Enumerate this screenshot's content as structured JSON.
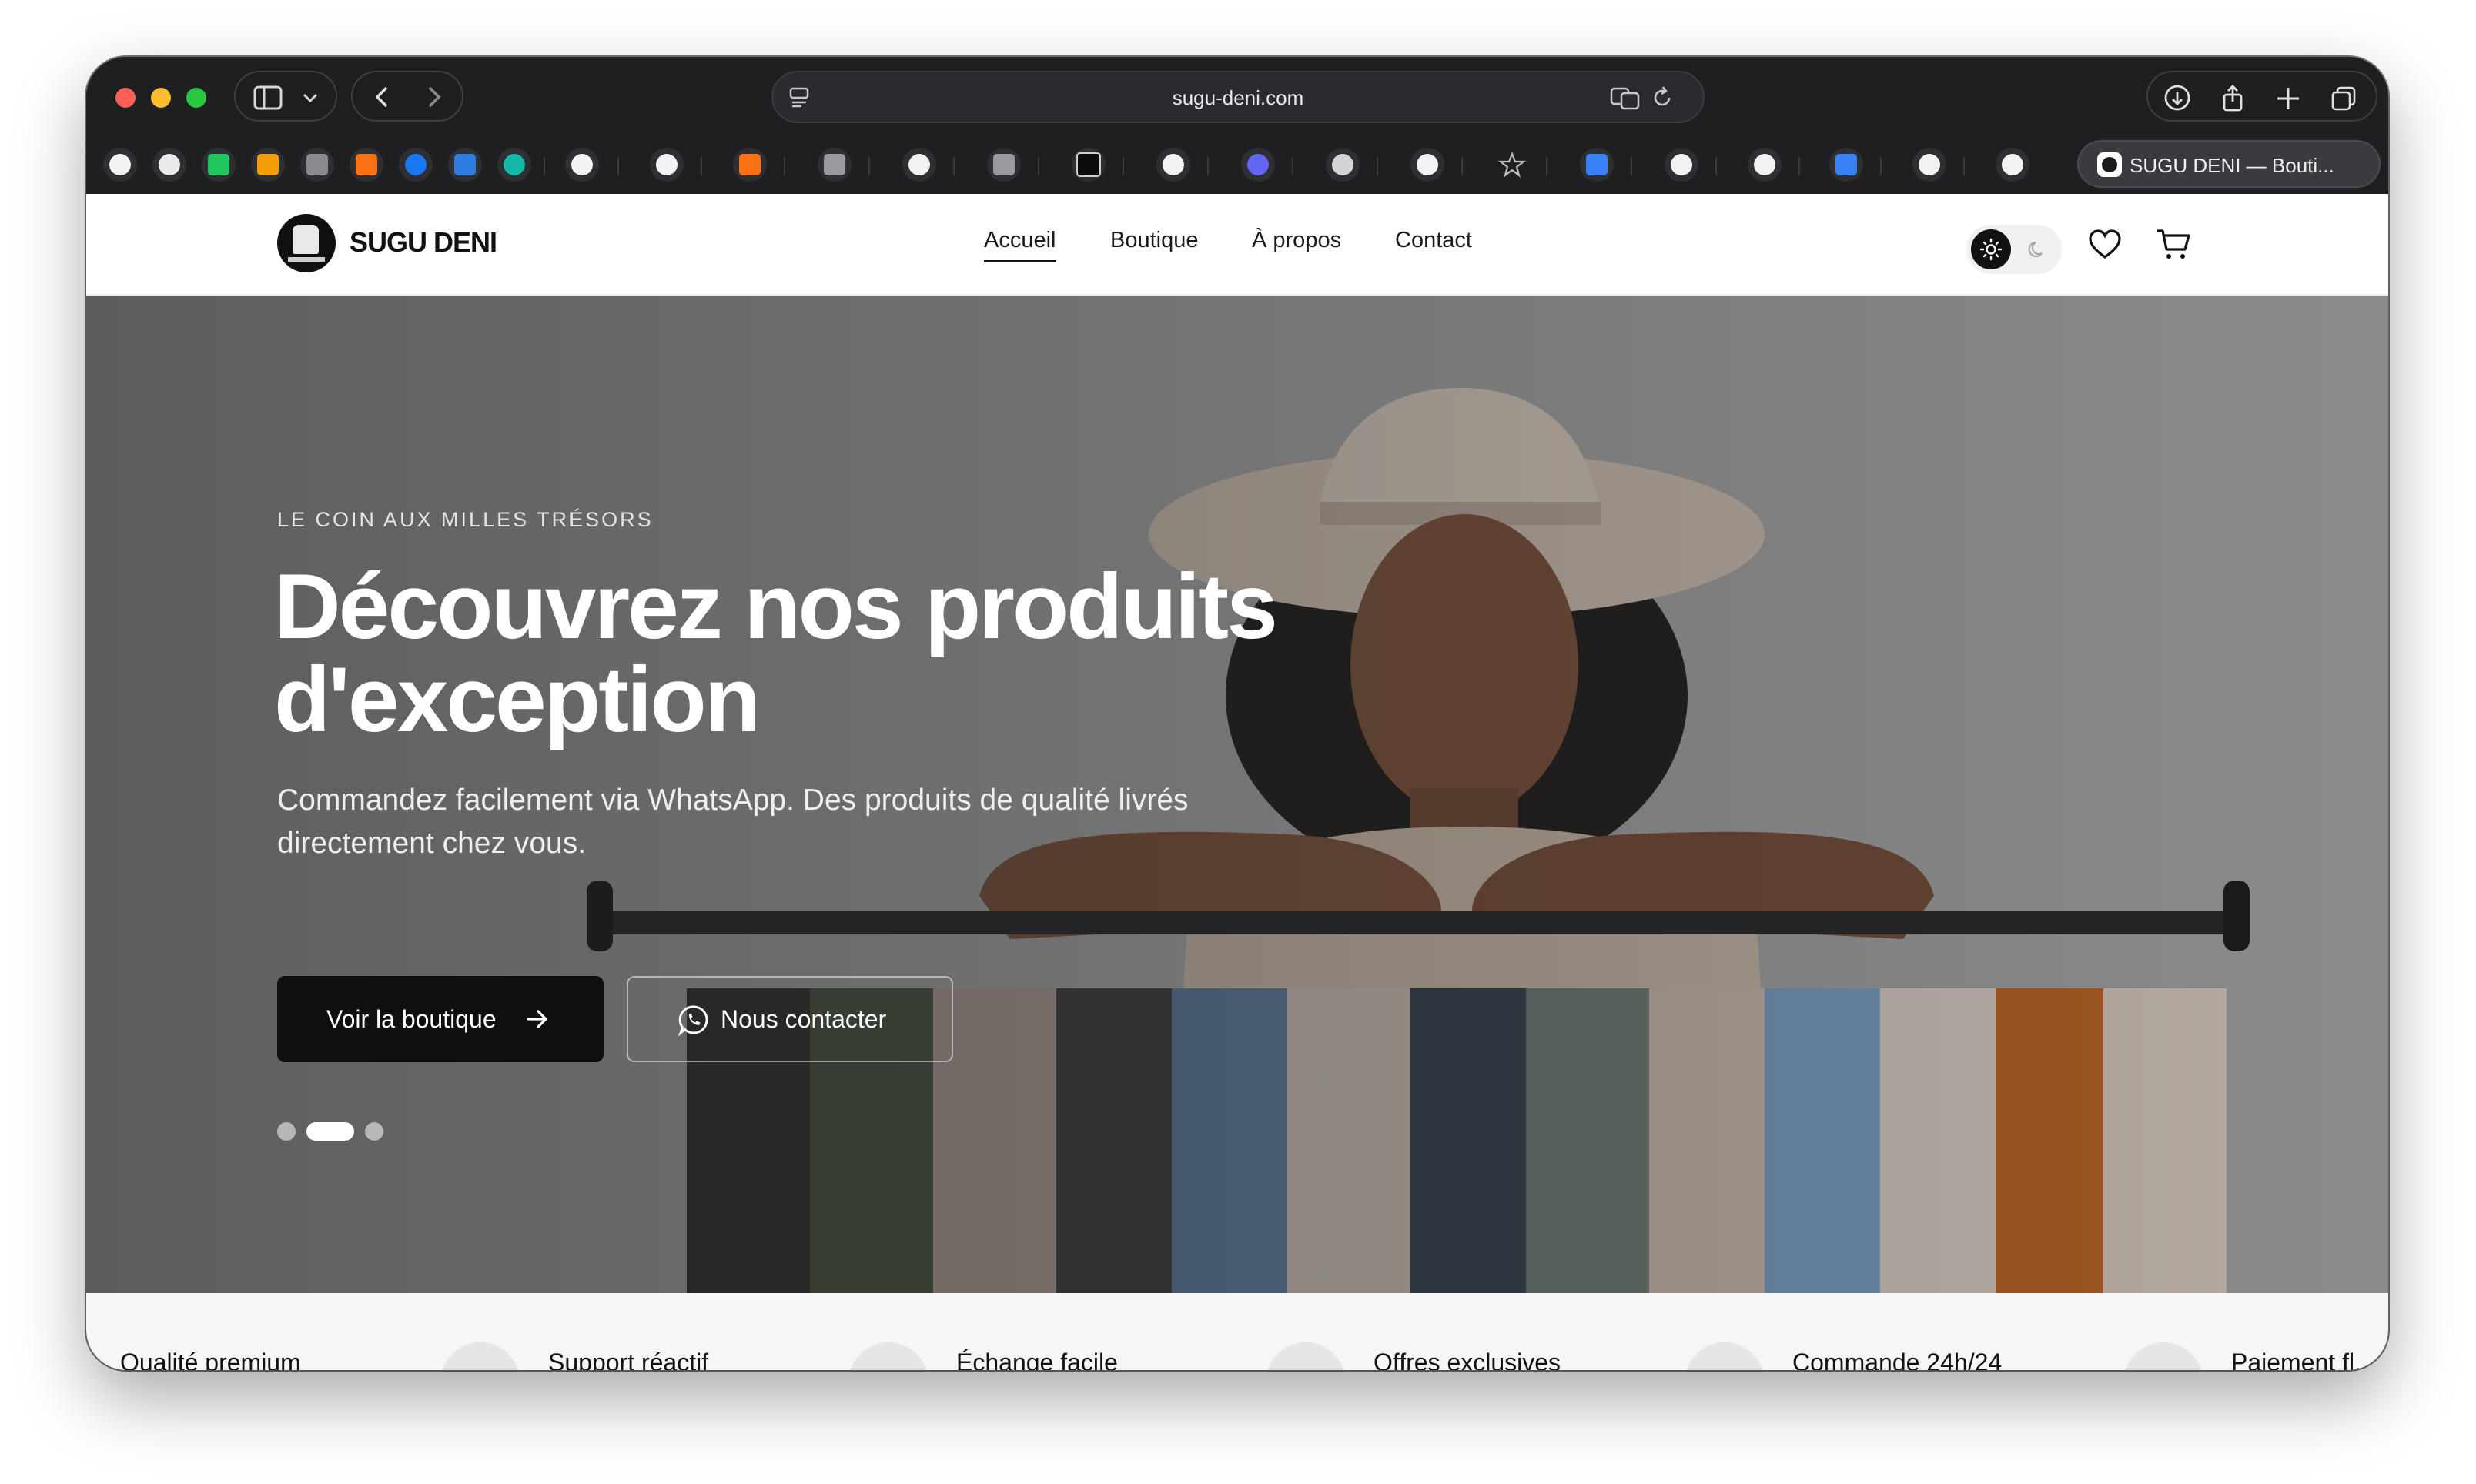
{
  "browser": {
    "url": "sugu-deni.com",
    "active_tab_title": "SUGU DENI — Bouti...",
    "bookmark_icons": [
      "triangle-icon",
      "circle-icon",
      "n-logo-icon",
      "bar-chart-icon",
      "g-icon",
      "flame-icon",
      "facebook-icon",
      "bing-icon",
      "globe-icon",
      "triangle-icon",
      "github-icon",
      "flame-icon",
      "l-icon",
      "google-icon",
      "s-icon",
      "terminal-icon",
      "refresh-icon",
      "pentagon-icon",
      "openai-icon",
      "refresh-icon",
      "star-icon",
      "puzzle-icon",
      "refresh-icon",
      "refresh-icon",
      "puzzle-icon",
      "refresh-icon",
      "refresh-icon"
    ]
  },
  "site": {
    "brand": "SUGU DENI",
    "nav": [
      {
        "label": "Accueil",
        "active": true
      },
      {
        "label": "Boutique",
        "active": false
      },
      {
        "label": "À propos",
        "active": false
      },
      {
        "label": "Contact",
        "active": false
      }
    ],
    "theme": "light"
  },
  "hero": {
    "eyebrow": "LE COIN AUX MILLES TRÉSORS",
    "title_line1": "Découvrez nos produits",
    "title_line2": "d'exception",
    "subtitle_line1": "Commandez facilement via WhatsApp. Des produits de qualité livrés",
    "subtitle_line2": "directement chez vous.",
    "primary_button": "Voir la boutique",
    "secondary_button": "Nous contacter",
    "slide_count": 3,
    "active_slide": 2
  },
  "features": [
    "Qualité premium",
    "Support réactif",
    "Échange facile",
    "Offres exclusives",
    "Commande 24h/24",
    "Paiement fl..."
  ],
  "colors": {
    "accent": "#0f0f0f",
    "chrome": "#1e1f21",
    "header_bg": "#ffffff"
  }
}
